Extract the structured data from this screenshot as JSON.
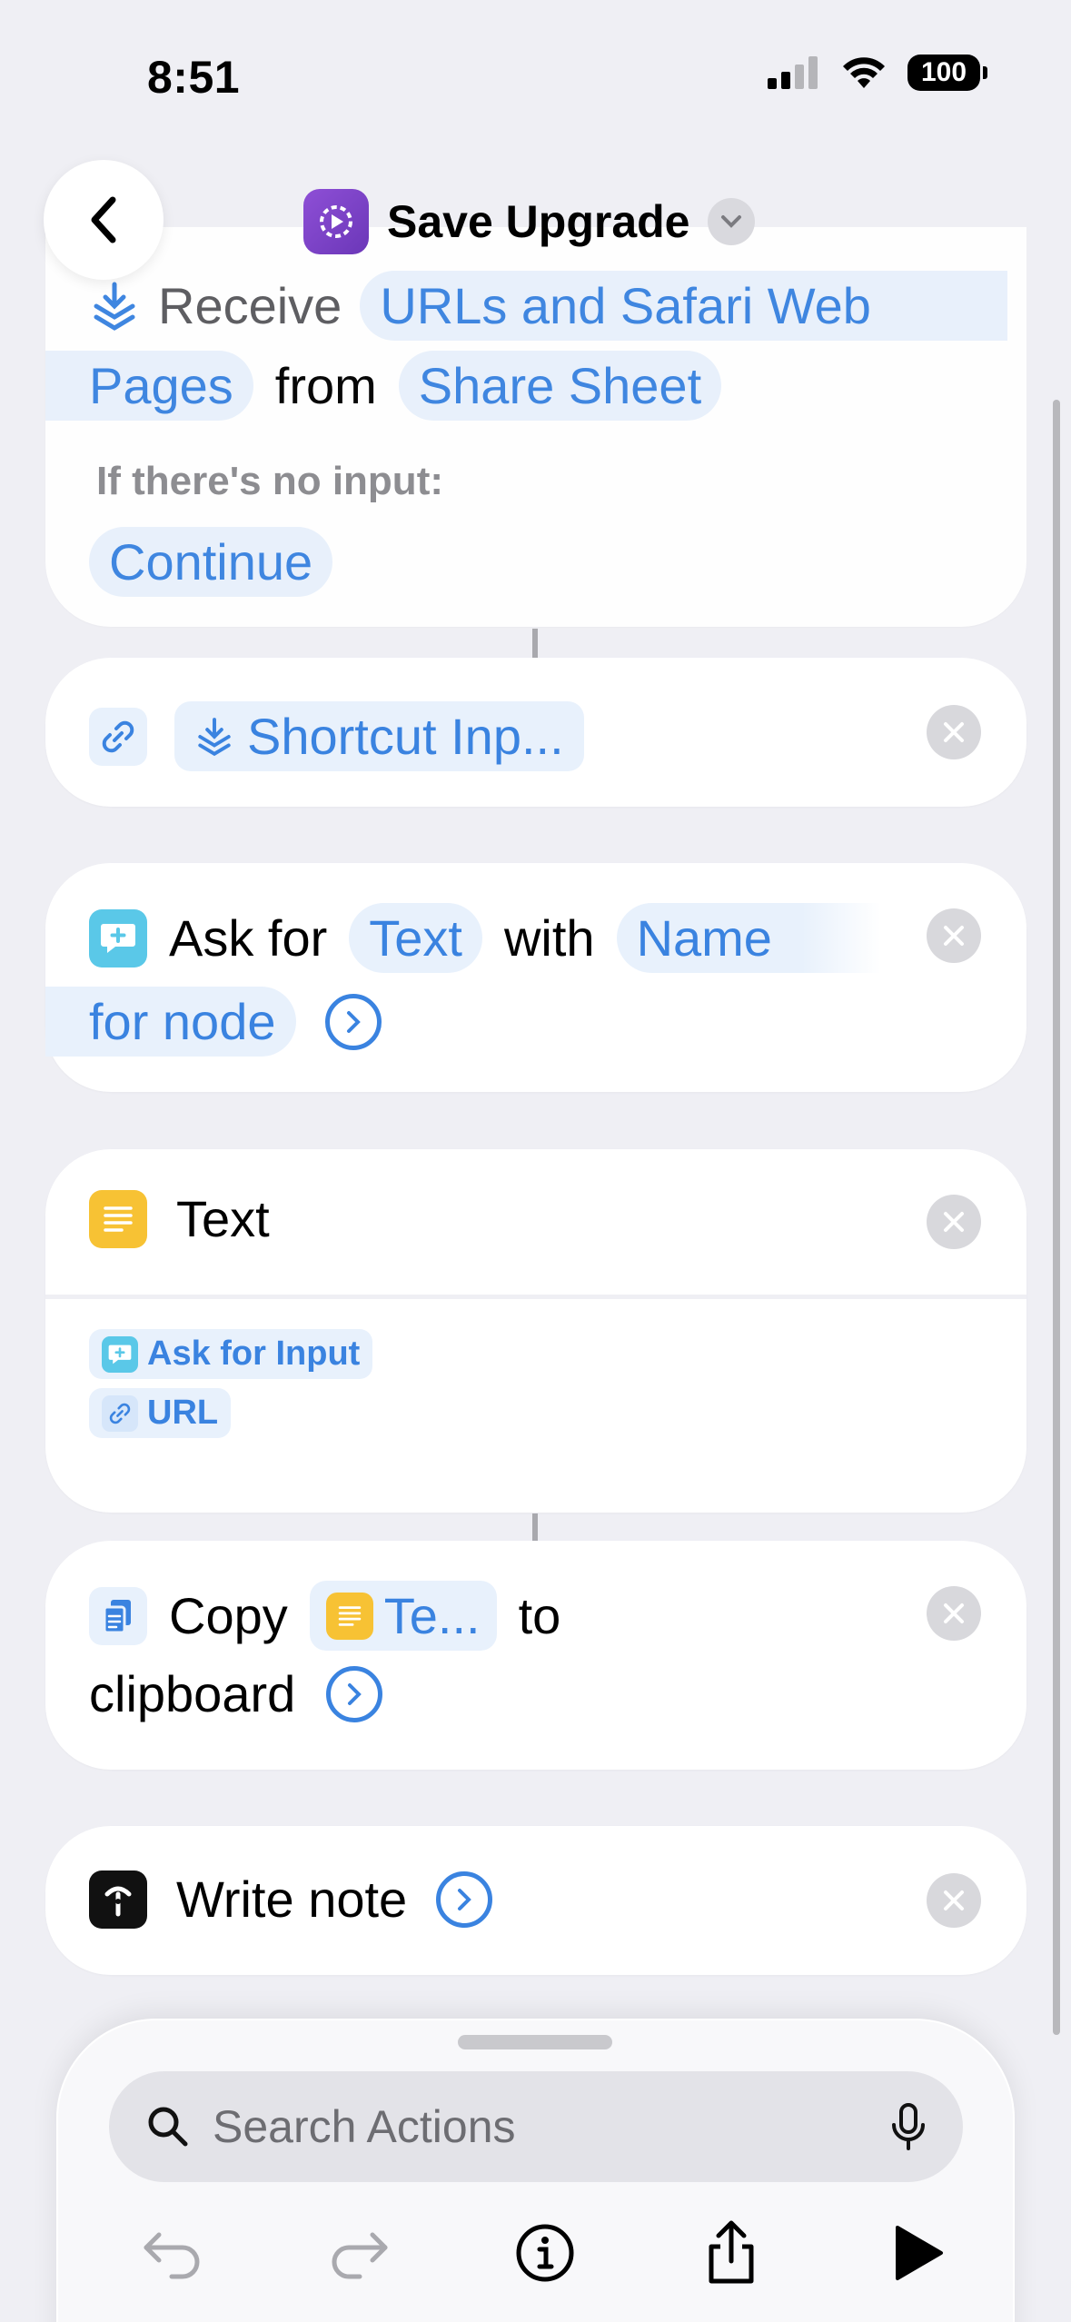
{
  "status_bar": {
    "time": "8:51",
    "battery": "100"
  },
  "header": {
    "title": "Save Upgrade",
    "back_icon": "chevron-left-icon",
    "app_icon": "shortcuts-app-icon"
  },
  "receive_card": {
    "receive_label": "Receive",
    "types_pill_1": "URLs and Safari Web",
    "types_pill_2": "Pages",
    "from_label": "from",
    "source_pill": "Share Sheet",
    "no_input_label": "If there's no input:",
    "no_input_value": "Continue"
  },
  "url_card": {
    "variable": "Shortcut Inp..."
  },
  "ask_card": {
    "ask_for": "Ask for",
    "type_pill": "Text",
    "with": "with",
    "prompt_pill_1": "Name",
    "prompt_pill_2": "for node"
  },
  "text_card": {
    "title": "Text",
    "token_1": "Ask for Input",
    "token_2": "URL"
  },
  "copy_card": {
    "copy": "Copy",
    "var_pill": "Te...",
    "to": "to",
    "clipboard": "clipboard"
  },
  "note_card": {
    "label": "Write note"
  },
  "bottom": {
    "search_placeholder": "Search Actions"
  },
  "colors": {
    "accent": "#3a83e0",
    "pill_bg": "#e8f1fc",
    "background": "#efeff4"
  }
}
